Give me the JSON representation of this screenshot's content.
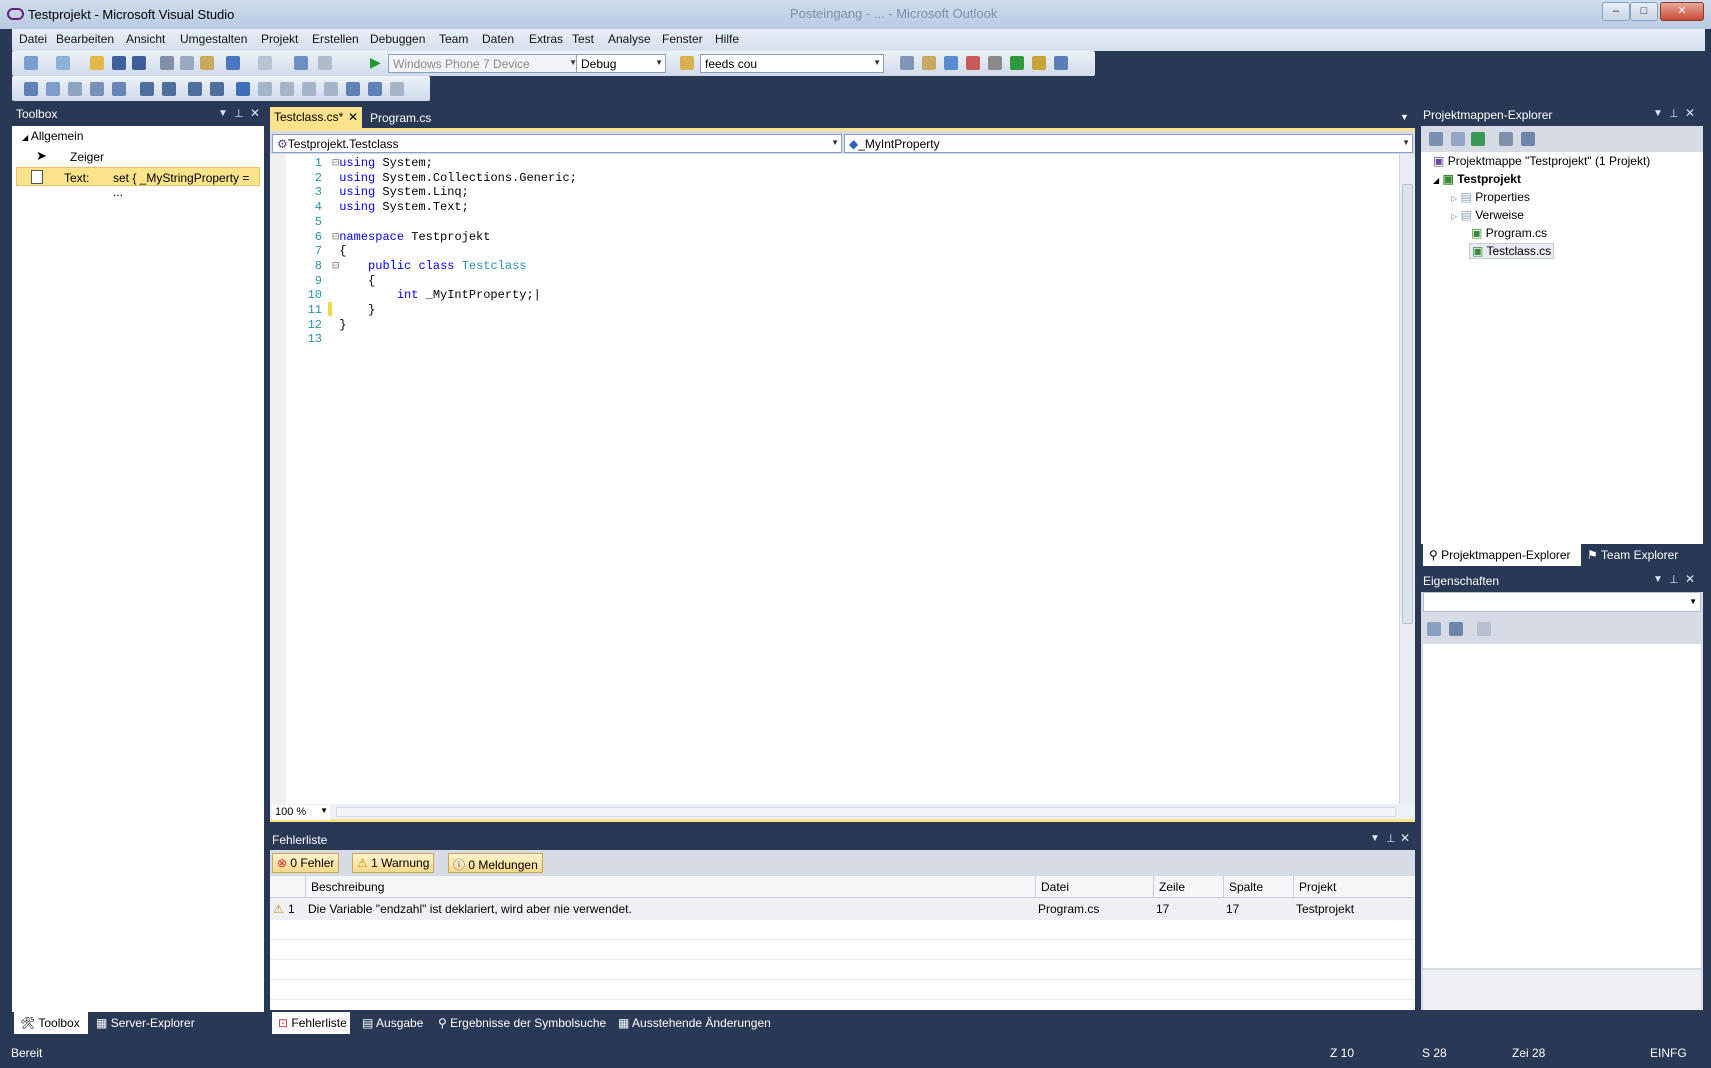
{
  "window": {
    "title": "Testprojekt - Microsoft Visual Studio",
    "bg_title": "Posteingang - ... - Microsoft Outlook",
    "min": "–",
    "max": "□",
    "close": "✕"
  },
  "menu": [
    "Datei",
    "Bearbeiten",
    "Ansicht",
    "Umgestalten",
    "Projekt",
    "Erstellen",
    "Debuggen",
    "Team",
    "Daten",
    "Extras",
    "Test",
    "Analyse",
    "Fenster",
    "Hilfe"
  ],
  "toolbar": {
    "device": "Windows Phone 7 Device",
    "config": "Debug",
    "find": "feeds cou"
  },
  "toolbox": {
    "title": "Toolbox",
    "group": "Allgemein",
    "items": [
      {
        "icon": "pointer-icon",
        "label": "Zeiger",
        "value": ""
      },
      {
        "icon": "text-snippet-icon",
        "label": "Text:",
        "value": "set { _MyStringProperty = ..."
      }
    ],
    "tabs": [
      "Toolbox",
      "Server-Explorer"
    ]
  },
  "editor": {
    "tabs": [
      {
        "label": "Testclass.cs*",
        "active": true
      },
      {
        "label": "Program.cs",
        "active": false
      }
    ],
    "type_dropdown": "Testprojekt.Testclass",
    "member_dropdown": "_MyIntProperty",
    "zoom": "100 %",
    "lines": [
      "1",
      "2",
      "3",
      "4",
      "5",
      "6",
      "7",
      "8",
      "9",
      "10",
      "11",
      "12",
      "13"
    ]
  },
  "solution": {
    "title": "Projektmappen-Explorer",
    "root": "Projektmappe \"Testprojekt\" (1 Projekt)",
    "project": "Testprojekt",
    "items": [
      "Properties",
      "Verweise",
      "Program.cs",
      "Testclass.cs"
    ],
    "tabs": [
      "Projektmappen-Explorer",
      "Team Explorer"
    ]
  },
  "properties": {
    "title": "Eigenschaften"
  },
  "errors": {
    "title": "Fehlerliste",
    "filters": [
      "0 Fehler",
      "1 Warnung",
      "0 Meldungen"
    ],
    "columns": [
      "Beschreibung",
      "Datei",
      "Zeile",
      "Spalte",
      "Projekt"
    ],
    "rows": [
      {
        "num": "1",
        "desc": "Die Variable \"endzahl\" ist deklariert, wird aber nie verwendet.",
        "file": "Program.cs",
        "line": "17",
        "col": "17",
        "project": "Testprojekt"
      }
    ]
  },
  "bottom_tabs": [
    "Fehlerliste",
    "Ausgabe",
    "Ergebnisse der Symbolsuche",
    "Ausstehende Änderungen"
  ],
  "status": {
    "text": "Bereit",
    "line": "Z 10",
    "col": "S 28",
    "char": "Zei 28",
    "mode": "EINFG"
  },
  "colors": {
    "accent": "#293955",
    "highlight": "#fbe38c",
    "keyword": "#0000ff",
    "type": "#2b91af"
  }
}
